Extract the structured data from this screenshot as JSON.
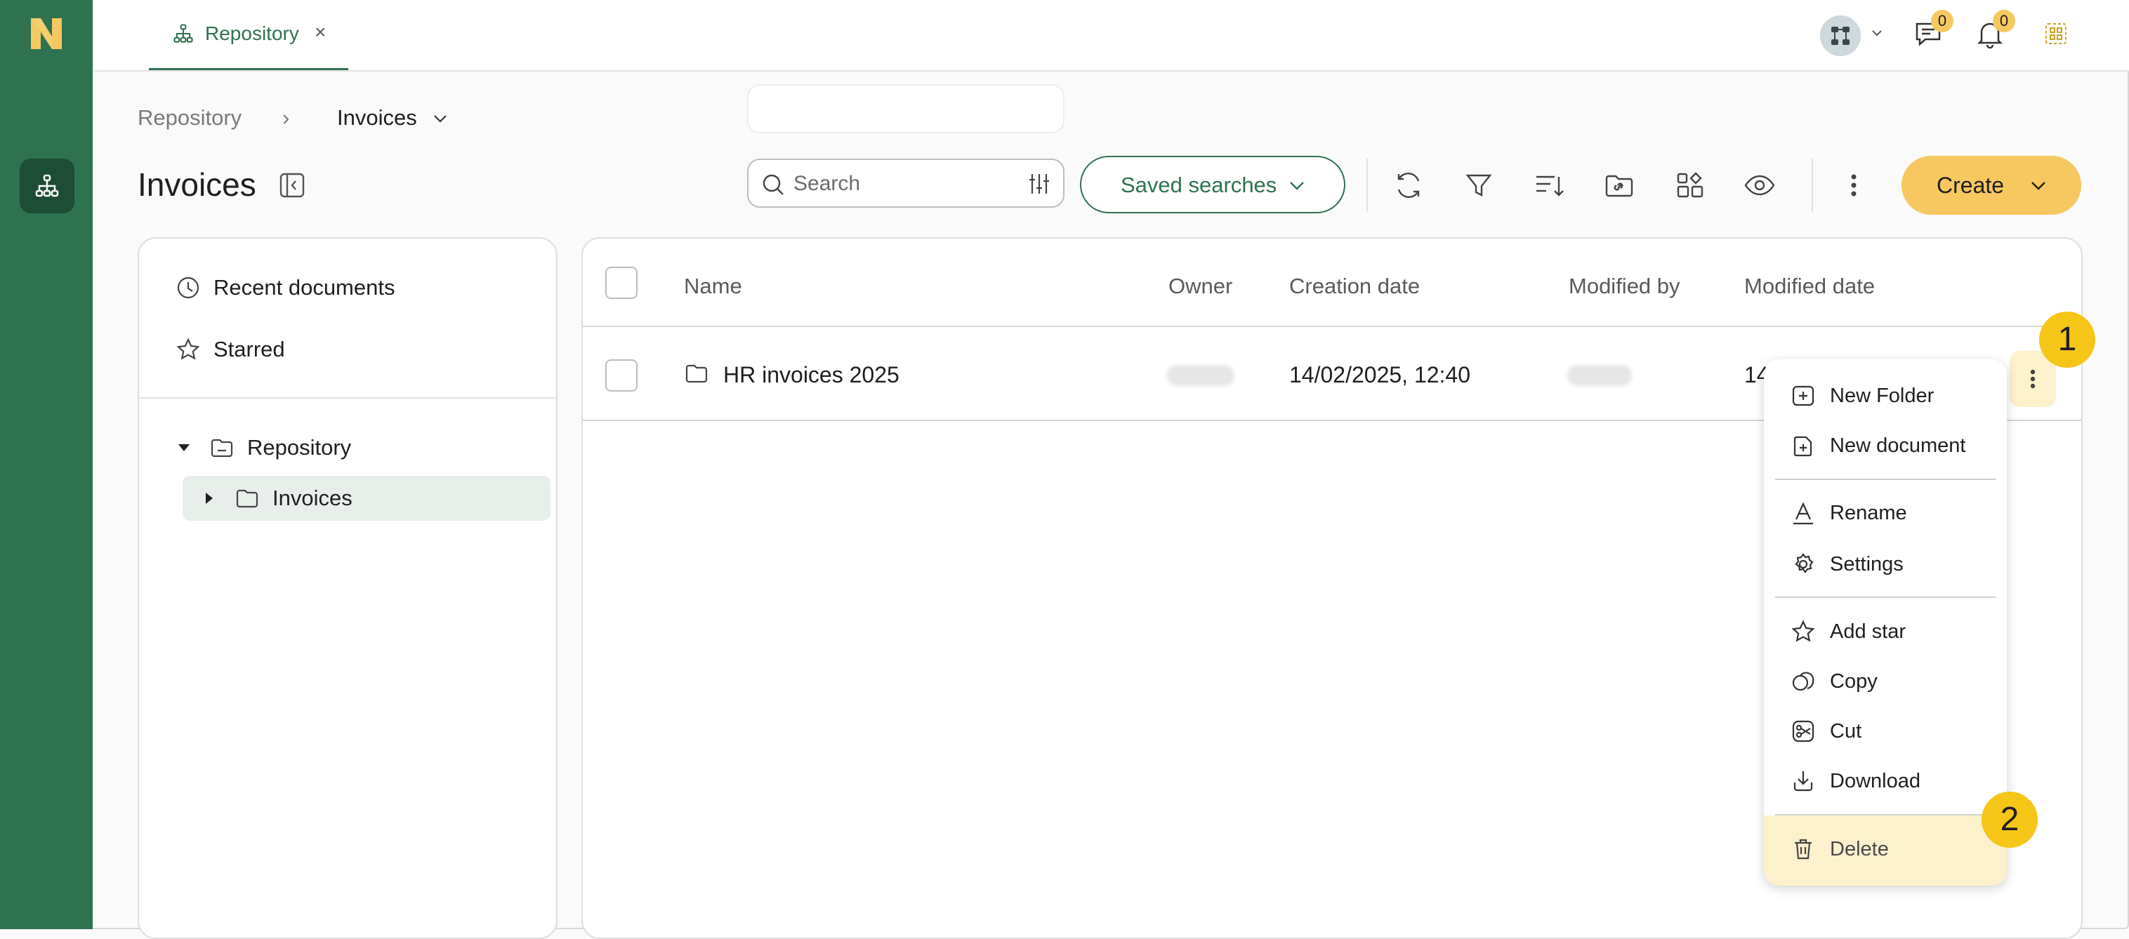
{
  "app": {
    "logo_letter": "N",
    "colors": {
      "brand_green": "#2e7250",
      "accent_yellow": "#f6c85f",
      "callout_yellow": "#f5c518"
    }
  },
  "rail": {
    "items": [
      {
        "icon": "search-icon"
      },
      {
        "icon": "repository-tree-icon"
      }
    ]
  },
  "topbar": {
    "tab": {
      "label": "Repository",
      "close": "×",
      "icon": "repository-tree-icon"
    },
    "messages_badge": "0",
    "notifications_badge": "0"
  },
  "breadcrumb": {
    "root": "Repository",
    "separator": "›",
    "current": "Invoices"
  },
  "page": {
    "title": "Invoices"
  },
  "toolbar": {
    "search_placeholder": "Search",
    "saved_searches_label": "Saved searches",
    "create_label": "Create",
    "tools": [
      "refresh-icon",
      "filter-icon",
      "sort-icon",
      "link-folder-icon",
      "layout-icon",
      "view-icon",
      "more-vertical-icon"
    ]
  },
  "left_panel": {
    "quick_links": [
      {
        "label": "Recent documents",
        "icon": "clock-icon"
      },
      {
        "label": "Starred",
        "icon": "star-icon"
      }
    ],
    "tree": {
      "root": "Repository",
      "child": "Invoices"
    }
  },
  "table": {
    "columns": [
      "Name",
      "Owner",
      "Creation date",
      "Modified by",
      "Modified date"
    ],
    "rows": [
      {
        "name": "HR invoices 2025",
        "creation_date": "14/02/2025, 12:40",
        "modified_date_prefix": "14"
      }
    ]
  },
  "context_menu": {
    "groups": [
      [
        {
          "label": "New Folder",
          "icon": "new-folder-icon"
        },
        {
          "label": "New document",
          "icon": "new-document-icon"
        }
      ],
      [
        {
          "label": "Rename",
          "icon": "rename-icon"
        },
        {
          "label": "Settings",
          "icon": "gear-icon"
        }
      ],
      [
        {
          "label": "Add star",
          "icon": "star-icon"
        },
        {
          "label": "Copy",
          "icon": "copy-icon"
        },
        {
          "label": "Cut",
          "icon": "scissors-icon"
        },
        {
          "label": "Download",
          "icon": "download-icon"
        }
      ],
      [
        {
          "label": "Delete",
          "icon": "trash-icon"
        }
      ]
    ]
  },
  "callouts": [
    "1",
    "2"
  ]
}
